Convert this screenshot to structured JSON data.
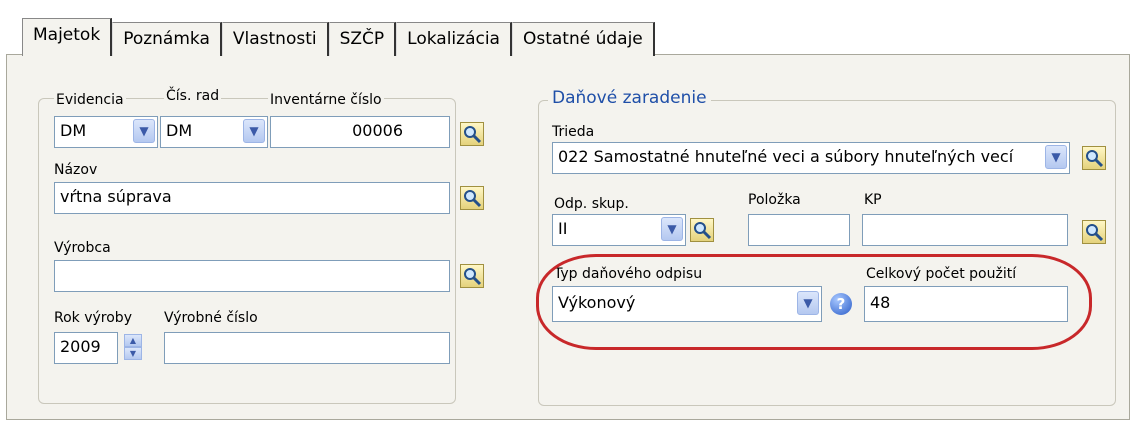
{
  "tabs": [
    {
      "label": "Majetok"
    },
    {
      "label": "Poznámka"
    },
    {
      "label": "Vlastnosti"
    },
    {
      "label": "SZČP"
    },
    {
      "label": "Lokalizácia"
    },
    {
      "label": "Ostatné údaje"
    }
  ],
  "left": {
    "evidencia": {
      "label": "Evidencia",
      "value": "DM"
    },
    "cis_rad": {
      "label": "Čís. rad",
      "value": "DM"
    },
    "inventarne": {
      "label": "Inventárne číslo",
      "value": "00006"
    },
    "nazov": {
      "label": "Názov",
      "value": "vŕtna súprava"
    },
    "vyrobca": {
      "label": "Výrobca",
      "value": ""
    },
    "rok": {
      "label": "Rok výroby",
      "value": "2009"
    },
    "vyrobne": {
      "label": "Výrobné číslo",
      "value": ""
    }
  },
  "right": {
    "group_title": "Daňové zaradenie",
    "trieda": {
      "label": "Trieda",
      "value": "022 Samostatné hnuteľné veci a súbory hnuteľných vecí"
    },
    "odp_skup": {
      "label": "Odp. skup.",
      "value": "II"
    },
    "polozka": {
      "label": "Položka",
      "value": ""
    },
    "kp": {
      "label": "KP",
      "value": ""
    },
    "typ": {
      "label": "Typ daňového odpisu",
      "value": "Výkonový"
    },
    "celkovy": {
      "label": "Celkový počet použití",
      "value": "48"
    }
  },
  "colors": {
    "accent": "#1f4fa8",
    "highlight": "#c8282a"
  },
  "icons": {
    "lookup": "lookup-icon",
    "dropdown": "chevron-down-icon",
    "help": "help-icon"
  }
}
